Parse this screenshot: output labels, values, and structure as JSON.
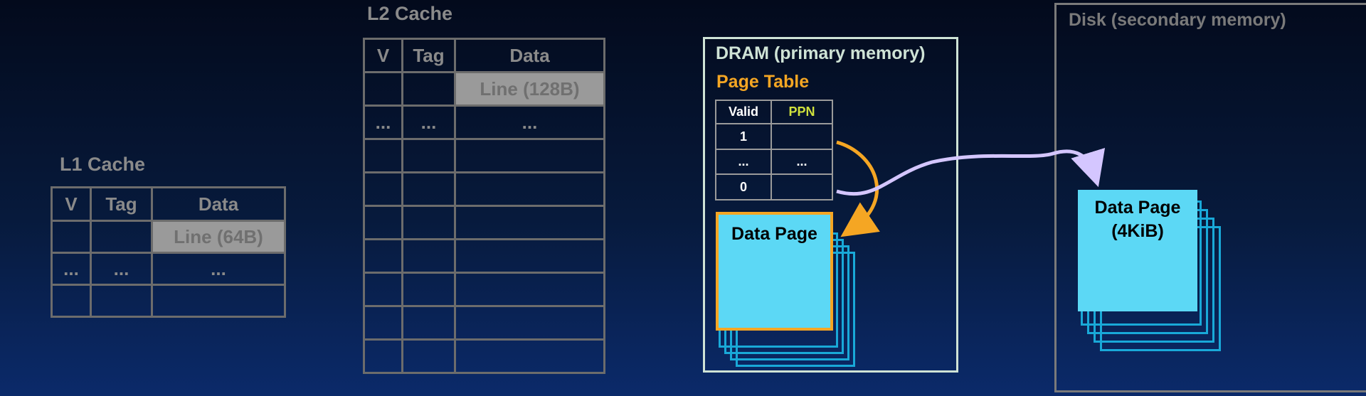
{
  "l1": {
    "title": "L1 Cache",
    "headers": [
      "V",
      "Tag",
      "Data"
    ],
    "rows": [
      [
        "",
        "",
        "Line (64B)"
      ],
      [
        "...",
        "...",
        "..."
      ],
      [
        "",
        "",
        ""
      ]
    ]
  },
  "l2": {
    "title": "L2 Cache",
    "headers": [
      "V",
      "Tag",
      "Data"
    ],
    "rows": [
      [
        "",
        "",
        "Line (128B)"
      ],
      [
        "...",
        "...",
        "..."
      ],
      [
        "",
        "",
        ""
      ],
      [
        "",
        "",
        ""
      ],
      [
        "",
        "",
        ""
      ],
      [
        "",
        "",
        ""
      ],
      [
        "",
        "",
        ""
      ],
      [
        "",
        "",
        ""
      ],
      [
        "",
        "",
        ""
      ]
    ]
  },
  "dram": {
    "title": "DRAM (primary memory)",
    "page_table_title": "Page Table",
    "page_table_headers": [
      "Valid",
      "PPN"
    ],
    "page_table_rows": [
      [
        "1",
        ""
      ],
      [
        "...",
        "..."
      ],
      [
        "0",
        ""
      ]
    ],
    "data_page_label": "Data Page"
  },
  "disk": {
    "title": "Disk (secondary memory)",
    "data_page_label_line1": "Data Page",
    "data_page_label_line2": "(4KiB)"
  },
  "colors": {
    "orange": "#f5a623",
    "lavender": "#d4c6ff",
    "cyan_fill": "#5cd8f5",
    "cyan_border": "#19a9d8",
    "dram_border": "#cfe3d6",
    "disk_border": "#7a7a7a",
    "ppn_header": "#cfe13d"
  }
}
